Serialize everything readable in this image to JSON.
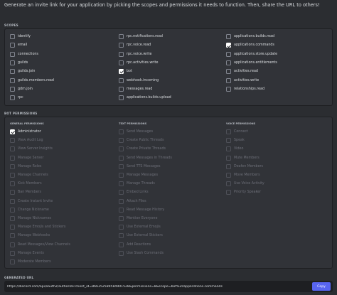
{
  "intro_text": "Generate an invite link for your application by picking the scopes and permissions it needs to function. Then, share the URL to others!",
  "scopes": {
    "label": "SCOPES",
    "columns": [
      [
        {
          "label": "identify",
          "checked": false
        },
        {
          "label": "email",
          "checked": false
        },
        {
          "label": "connections",
          "checked": false
        },
        {
          "label": "guilds",
          "checked": false
        },
        {
          "label": "guilds.join",
          "checked": false
        },
        {
          "label": "guilds.members.read",
          "checked": false
        },
        {
          "label": "gdm.join",
          "checked": false
        },
        {
          "label": "rpc",
          "checked": false
        }
      ],
      [
        {
          "label": "rpc.notifications.read",
          "checked": false
        },
        {
          "label": "rpc.voice.read",
          "checked": false
        },
        {
          "label": "rpc.voice.write",
          "checked": false
        },
        {
          "label": "rpc.activities.write",
          "checked": false
        },
        {
          "label": "bot",
          "checked": true
        },
        {
          "label": "webhook.incoming",
          "checked": false
        },
        {
          "label": "messages.read",
          "checked": false
        },
        {
          "label": "applications.builds.upload",
          "checked": false
        }
      ],
      [
        {
          "label": "applications.builds.read",
          "checked": false
        },
        {
          "label": "applications.commands",
          "checked": true
        },
        {
          "label": "applications.store.update",
          "checked": false
        },
        {
          "label": "applications.entitlements",
          "checked": false
        },
        {
          "label": "activities.read",
          "checked": false
        },
        {
          "label": "activities.write",
          "checked": false
        },
        {
          "label": "relationships.read",
          "checked": false
        }
      ]
    ]
  },
  "bot_permissions": {
    "label": "BOT PERMISSIONS",
    "columns": [
      {
        "heading": "GENERAL PERMISSIONS",
        "items": [
          {
            "label": "Administrator",
            "checked": true,
            "disabled": false
          },
          {
            "label": "View Audit Log",
            "checked": false,
            "disabled": true
          },
          {
            "label": "View Server Insights",
            "checked": false,
            "disabled": true
          },
          {
            "label": "Manage Server",
            "checked": false,
            "disabled": true
          },
          {
            "label": "Manage Roles",
            "checked": false,
            "disabled": true
          },
          {
            "label": "Manage Channels",
            "checked": false,
            "disabled": true
          },
          {
            "label": "Kick Members",
            "checked": false,
            "disabled": true
          },
          {
            "label": "Ban Members",
            "checked": false,
            "disabled": true
          },
          {
            "label": "Create Instant Invite",
            "checked": false,
            "disabled": true
          },
          {
            "label": "Change Nickname",
            "checked": false,
            "disabled": true
          },
          {
            "label": "Manage Nicknames",
            "checked": false,
            "disabled": true
          },
          {
            "label": "Manage Emojis and Stickers",
            "checked": false,
            "disabled": true
          },
          {
            "label": "Manage Webhooks",
            "checked": false,
            "disabled": true
          },
          {
            "label": "Read Messages/View Channels",
            "checked": false,
            "disabled": true
          },
          {
            "label": "Manage Events",
            "checked": false,
            "disabled": true
          },
          {
            "label": "Moderate Members",
            "checked": false,
            "disabled": true
          }
        ]
      },
      {
        "heading": "TEXT PERMISSIONS",
        "items": [
          {
            "label": "Send Messages",
            "checked": false,
            "disabled": true
          },
          {
            "label": "Create Public Threads",
            "checked": false,
            "disabled": true
          },
          {
            "label": "Create Private Threads",
            "checked": false,
            "disabled": true
          },
          {
            "label": "Send Messages in Threads",
            "checked": false,
            "disabled": true
          },
          {
            "label": "Send TTS Messages",
            "checked": false,
            "disabled": true
          },
          {
            "label": "Manage Messages",
            "checked": false,
            "disabled": true
          },
          {
            "label": "Manage Threads",
            "checked": false,
            "disabled": true
          },
          {
            "label": "Embed Links",
            "checked": false,
            "disabled": true
          },
          {
            "label": "Attach Files",
            "checked": false,
            "disabled": true
          },
          {
            "label": "Read Message History",
            "checked": false,
            "disabled": true
          },
          {
            "label": "Mention Everyone",
            "checked": false,
            "disabled": true
          },
          {
            "label": "Use External Emojis",
            "checked": false,
            "disabled": true
          },
          {
            "label": "Use External Stickers",
            "checked": false,
            "disabled": true
          },
          {
            "label": "Add Reactions",
            "checked": false,
            "disabled": true
          },
          {
            "label": "Use Slash Commands",
            "checked": false,
            "disabled": true
          }
        ]
      },
      {
        "heading": "VOICE PERMISSIONS",
        "items": [
          {
            "label": "Connect",
            "checked": false,
            "disabled": true
          },
          {
            "label": "Speak",
            "checked": false,
            "disabled": true
          },
          {
            "label": "Video",
            "checked": false,
            "disabled": true
          },
          {
            "label": "Mute Members",
            "checked": false,
            "disabled": true
          },
          {
            "label": "Deafen Members",
            "checked": false,
            "disabled": true
          },
          {
            "label": "Move Members",
            "checked": false,
            "disabled": true
          },
          {
            "label": "Use Voice Activity",
            "checked": false,
            "disabled": true
          },
          {
            "label": "Priority Speaker",
            "checked": false,
            "disabled": true
          }
        ]
      }
    ]
  },
  "generated_url": {
    "label": "GENERATED URL",
    "url": "https://discord.com/api/oauth2/authorize?client_id=866352589584901528&permissions=8&scope=bot%20applications.commands",
    "copy_label": "Copy"
  },
  "colors": {
    "background": "#2b2d31",
    "panel": "#313338",
    "accent": "#5865f2",
    "checked": "#ffffff"
  }
}
